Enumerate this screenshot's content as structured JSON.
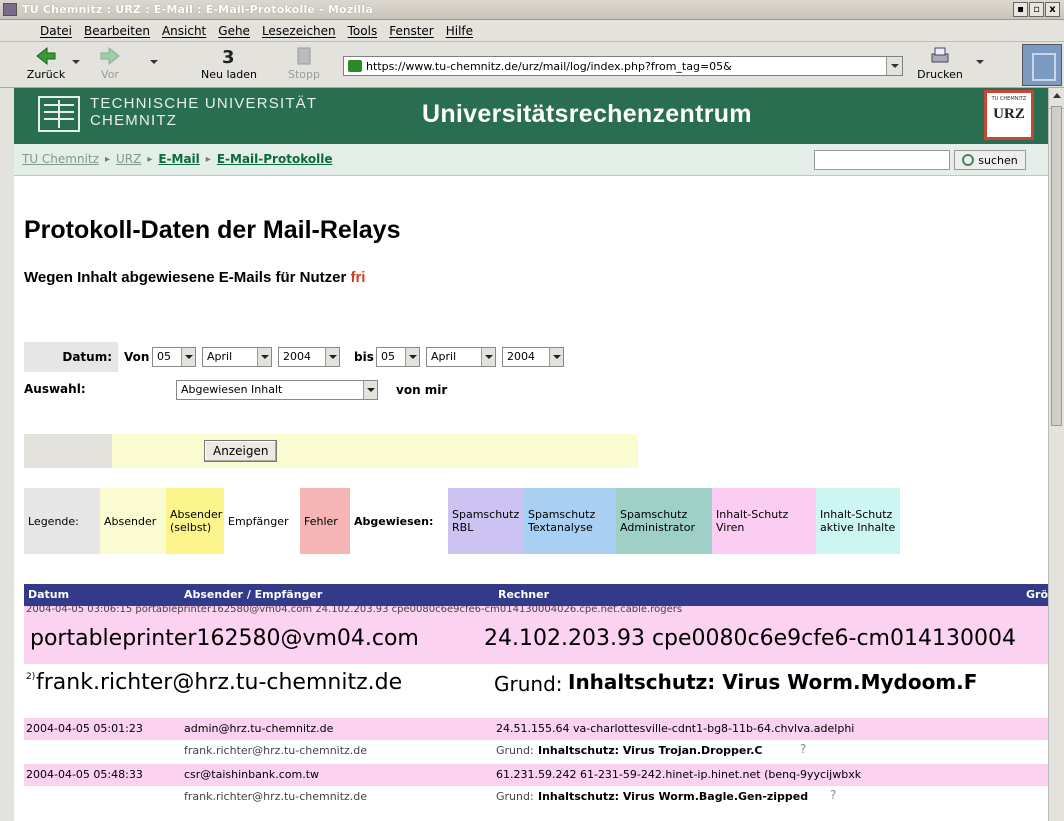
{
  "window": {
    "title": "TU Chemnitz : URZ : E-Mail : E-Mail-Protokolle - Mozilla",
    "buttons": [
      "▪",
      "▫",
      "x"
    ]
  },
  "menu": [
    "Datei",
    "Bearbeiten",
    "Ansicht",
    "Gehe",
    "Lesezeichen",
    "Tools",
    "Fenster",
    "Hilfe"
  ],
  "toolbar": {
    "back": "Zurück",
    "forward": "Vor",
    "reload": "Neu laden",
    "stop": "Stopp",
    "url": "https://www.tu-chemnitz.de/urz/mail/log/index.php?from_tag=05&",
    "print": "Drucken"
  },
  "banner": {
    "uni_line1": "TECHNISCHE UNIVERSITÄT",
    "uni_line2": "CHEMNITZ",
    "title": "Universitätsrechenzentrum",
    "badge": "URZ",
    "badge_small": "TU CHEMNITZ"
  },
  "breadcrumb": [
    "TU Chemnitz",
    "URZ",
    "E-Mail",
    "E-Mail-Protokolle"
  ],
  "search": {
    "value": "",
    "button": "suchen"
  },
  "page": {
    "title": "Protokoll-Daten der Mail-Relays",
    "subtitle": "Wegen Inhalt abgewiesene E-Mails für Nutzer",
    "user": "fri"
  },
  "form": {
    "date_label": "Datum:",
    "from_label": "Von",
    "to_label": "bis",
    "from": {
      "day": "05",
      "month": "April",
      "year": "2004"
    },
    "to": {
      "day": "05",
      "month": "April",
      "year": "2004"
    },
    "selection_label": "Auswahl:",
    "selection_value": "Abgewiesen Inhalt",
    "selection_suffix": "von mir",
    "submit": "Anzeigen"
  },
  "legend": {
    "label": "Legende:",
    "items": [
      {
        "text": "Absender",
        "color": "#fbfbd2"
      },
      {
        "text": "Absender (selbst)",
        "color": "#fbf58c"
      },
      {
        "text": "Empfänger",
        "color": "#ffffff"
      },
      {
        "text": "Fehler",
        "color": "#f5b5b5"
      },
      {
        "text": "Abgewiesen:",
        "color": "#ffffff",
        "bold": true
      },
      {
        "text": "Spamschutz RBL",
        "color": "#cdc3f2"
      },
      {
        "text": "Spamschutz Textanalyse",
        "color": "#a9cff2"
      },
      {
        "text": "Spamschutz Administrator",
        "color": "#9fd0c8"
      },
      {
        "text": "Inhalt-Schutz Viren",
        "color": "#fbcdf2"
      },
      {
        "text": "Inhalt-Schutz aktive Inhalte",
        "color": "#cdf5f2"
      }
    ]
  },
  "table": {
    "headers": [
      "Datum",
      "Absender / Empfänger",
      "Rechner",
      "Grö"
    ],
    "zoom": {
      "cut_text": "2004-04-05 03:06:15  portableprinter162580@vm04.com         24.102.203.93 cpe0080c6e9cfe6-cm014130004026.cpe.net.cable.rogers",
      "sender": "portableprinter162580@vm04.com",
      "host": "24.102.203.93 cpe0080c6e9cfe6-cm014130004",
      "recipient": "frank.richter@hrz.tu-chemnitz.de",
      "reason_label": "Grund:",
      "reason": "Inhaltschutz: Virus Worm.Mydoom.F",
      "marker": "2)"
    },
    "rows": [
      {
        "date": "2004-04-05 05:01:23",
        "sender": "admin@hrz.tu-chemnitz.de",
        "host": "24.51.155.64 va-charlottesville-cdnt1-bg8-11b-64.chvlva.adelphi",
        "recipient": "frank.richter@hrz.tu-chemnitz.de",
        "reason_label": "Grund:",
        "reason": "Inhaltschutz: Virus Trojan.Dropper.C"
      },
      {
        "date": "2004-04-05 05:48:33",
        "sender": "csr@taishinbank.com.tw",
        "host": "61.231.59.242 61-231-59-242.hinet-ip.hinet.net (benq-9yycijwbxk",
        "recipient": "frank.richter@hrz.tu-chemnitz.de",
        "reason_label": "Grund:",
        "reason": "Inhaltschutz: Virus Worm.Bagle.Gen-zipped"
      }
    ],
    "help": "?"
  },
  "colors": {
    "banner": "#2a6e52",
    "table_header": "#333a8a",
    "row_pink": "#fbd2f0",
    "user_highlight": "#d04020"
  }
}
